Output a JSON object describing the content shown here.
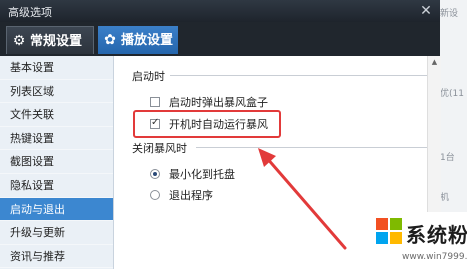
{
  "window": {
    "title": "高级选项"
  },
  "tabs": [
    {
      "label": "常规设置",
      "icon": "gear-icon"
    },
    {
      "label": "播放设置",
      "icon": "play-settings-icon"
    }
  ],
  "sidebar": {
    "items": [
      {
        "label": "基本设置"
      },
      {
        "label": "列表区域"
      },
      {
        "label": "文件关联"
      },
      {
        "label": "热键设置"
      },
      {
        "label": "截图设置"
      },
      {
        "label": "隐私设置"
      },
      {
        "label": "启动与退出"
      },
      {
        "label": "升级与更新"
      },
      {
        "label": "资讯与推荐"
      }
    ],
    "selected": "启动与退出"
  },
  "content": {
    "startup": {
      "section_title": "启动时",
      "options": [
        {
          "label": "启动时弹出暴风盒子",
          "checked": false
        },
        {
          "label": "开机时自动运行暴风",
          "checked": true
        }
      ]
    },
    "close_player": {
      "section_title": "关闭暴风时",
      "options": [
        {
          "label": "最小化到托盘",
          "selected": true
        },
        {
          "label": "退出程序",
          "selected": false
        }
      ]
    }
  },
  "background_text": [
    "新设",
    "优(11",
    "1台",
    "机"
  ],
  "watermark": {
    "brand": "系统粉",
    "url": "www.win7999.com",
    "colors": [
      "#f25022",
      "#7fba00",
      "#00a4ef",
      "#ffb900"
    ]
  },
  "annotation": {
    "color": "#e23a3a"
  }
}
